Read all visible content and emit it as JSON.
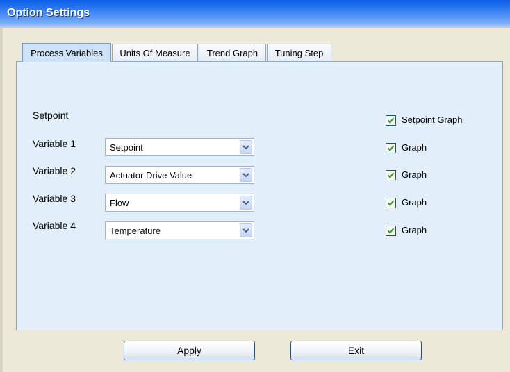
{
  "window": {
    "title": "Option Settings"
  },
  "tabs": [
    {
      "label": "Process Variables",
      "active": true
    },
    {
      "label": "Units Of Measure",
      "active": false
    },
    {
      "label": "Trend Graph",
      "active": false
    },
    {
      "label": "Tuning Step",
      "active": false
    }
  ],
  "setpoint": {
    "label": "Setpoint",
    "graph_label": "Setpoint Graph",
    "graph_checked": true
  },
  "variables": [
    {
      "label": "Variable 1",
      "value": "Setpoint",
      "graph_label": "Graph",
      "graph_checked": true
    },
    {
      "label": "Variable 2",
      "value": "Actuator Drive Value",
      "graph_label": "Graph",
      "graph_checked": true
    },
    {
      "label": "Variable 3",
      "value": "Flow",
      "graph_label": "Graph",
      "graph_checked": true
    },
    {
      "label": "Variable 4",
      "value": "Temperature",
      "graph_label": "Graph",
      "graph_checked": true
    }
  ],
  "buttons": {
    "apply": "Apply",
    "exit": "Exit"
  },
  "colors": {
    "title_bar": "#2e78f0",
    "panel": "#e2eef9",
    "check": "#2e9a2e"
  },
  "icons": {
    "dropdown": "chevron-down-icon",
    "check": "checkmark-icon"
  }
}
